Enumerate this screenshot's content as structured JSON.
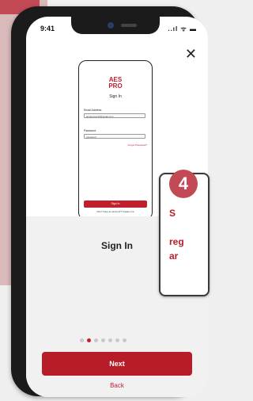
{
  "status_bar": {
    "time": "9:41",
    "icons": "..ıl ᯤ ▬"
  },
  "close_label": "✕",
  "mockup": {
    "logo_line1": "AES",
    "logo_line2": "PRO",
    "title": "Sign In",
    "email_label": "Email Address",
    "email_value": "jacquelyne12@gmail.com",
    "password_label": "Password",
    "password_value": "password",
    "forgot_label": "Forgot Password?",
    "signin_button": "Sign In",
    "signup_text": "Don't have an account? Create one"
  },
  "onboarding": {
    "headline": "Sign In",
    "dots_count": 7,
    "active_dot": 1,
    "next_label": "Next",
    "back_label": "Back"
  },
  "callout": {
    "step_number": "4",
    "line1": "S",
    "line2": "reg",
    "line3": "ar"
  }
}
